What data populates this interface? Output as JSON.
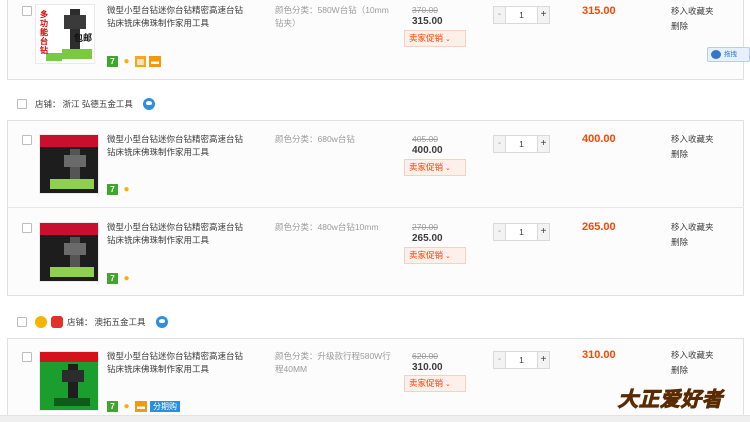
{
  "float_button": {
    "label": "拖拽"
  },
  "shops": [
    {
      "label": "店铺：",
      "name": "浙江 弘德五金工具"
    },
    {
      "label": "店铺：",
      "name": "澳拓五金工具"
    }
  ],
  "items": [
    {
      "title": "微型小型台钻迷你台钻精密高速台钻钻床铣床佛珠制作家用工具",
      "sku": "颜色分类：580W台钻（10mm钻夹）",
      "original_price": "370.00",
      "price": "315.00",
      "promo": "卖家促销",
      "quantity": "1",
      "total": "315.00",
      "thumb_text": [
        "多",
        "功",
        "能",
        "台",
        "钻",
        "包邮"
      ],
      "actions": [
        "移入收藏夹",
        "删除"
      ]
    },
    {
      "title": "微型小型台钻迷你台钻精密高速台钻钻床铣床佛珠制作家用工具",
      "sku": "颜色分类：680w台钻",
      "original_price": "405.00",
      "price": "400.00",
      "promo": "卖家促销",
      "quantity": "1",
      "total": "400.00",
      "actions": [
        "移入收藏夹",
        "删除"
      ]
    },
    {
      "title": "微型小型台钻迷你台钻精密高速台钻钻床铣床佛珠制作家用工具",
      "sku": "颜色分类：480w台钻10mm",
      "original_price": "270.00",
      "price": "265.00",
      "promo": "卖家促销",
      "quantity": "1",
      "total": "265.00",
      "actions": [
        "移入收藏夹",
        "删除"
      ]
    },
    {
      "title": "微型小型台钻迷你台钻精密高速台钻钻床铣床佛珠制作家用工具",
      "sku": "颜色分类：升级款行程580W行程40MM",
      "original_price": "620.00",
      "price": "310.00",
      "promo": "卖家促销",
      "quantity": "1",
      "total": "310.00",
      "actions": [
        "移入收藏夹",
        "删除"
      ],
      "installment_badge": "分期购"
    }
  ],
  "qty_controls": {
    "minus": "-",
    "plus": "+"
  },
  "badges": {
    "seven": "7"
  },
  "watermark": {
    "text": "大正爱好者"
  },
  "colors": {
    "accent": "#ff4400",
    "promo_bg": "#fdf0ea",
    "wangwang": "#2f8ede",
    "badge_green": "#41a62d"
  }
}
